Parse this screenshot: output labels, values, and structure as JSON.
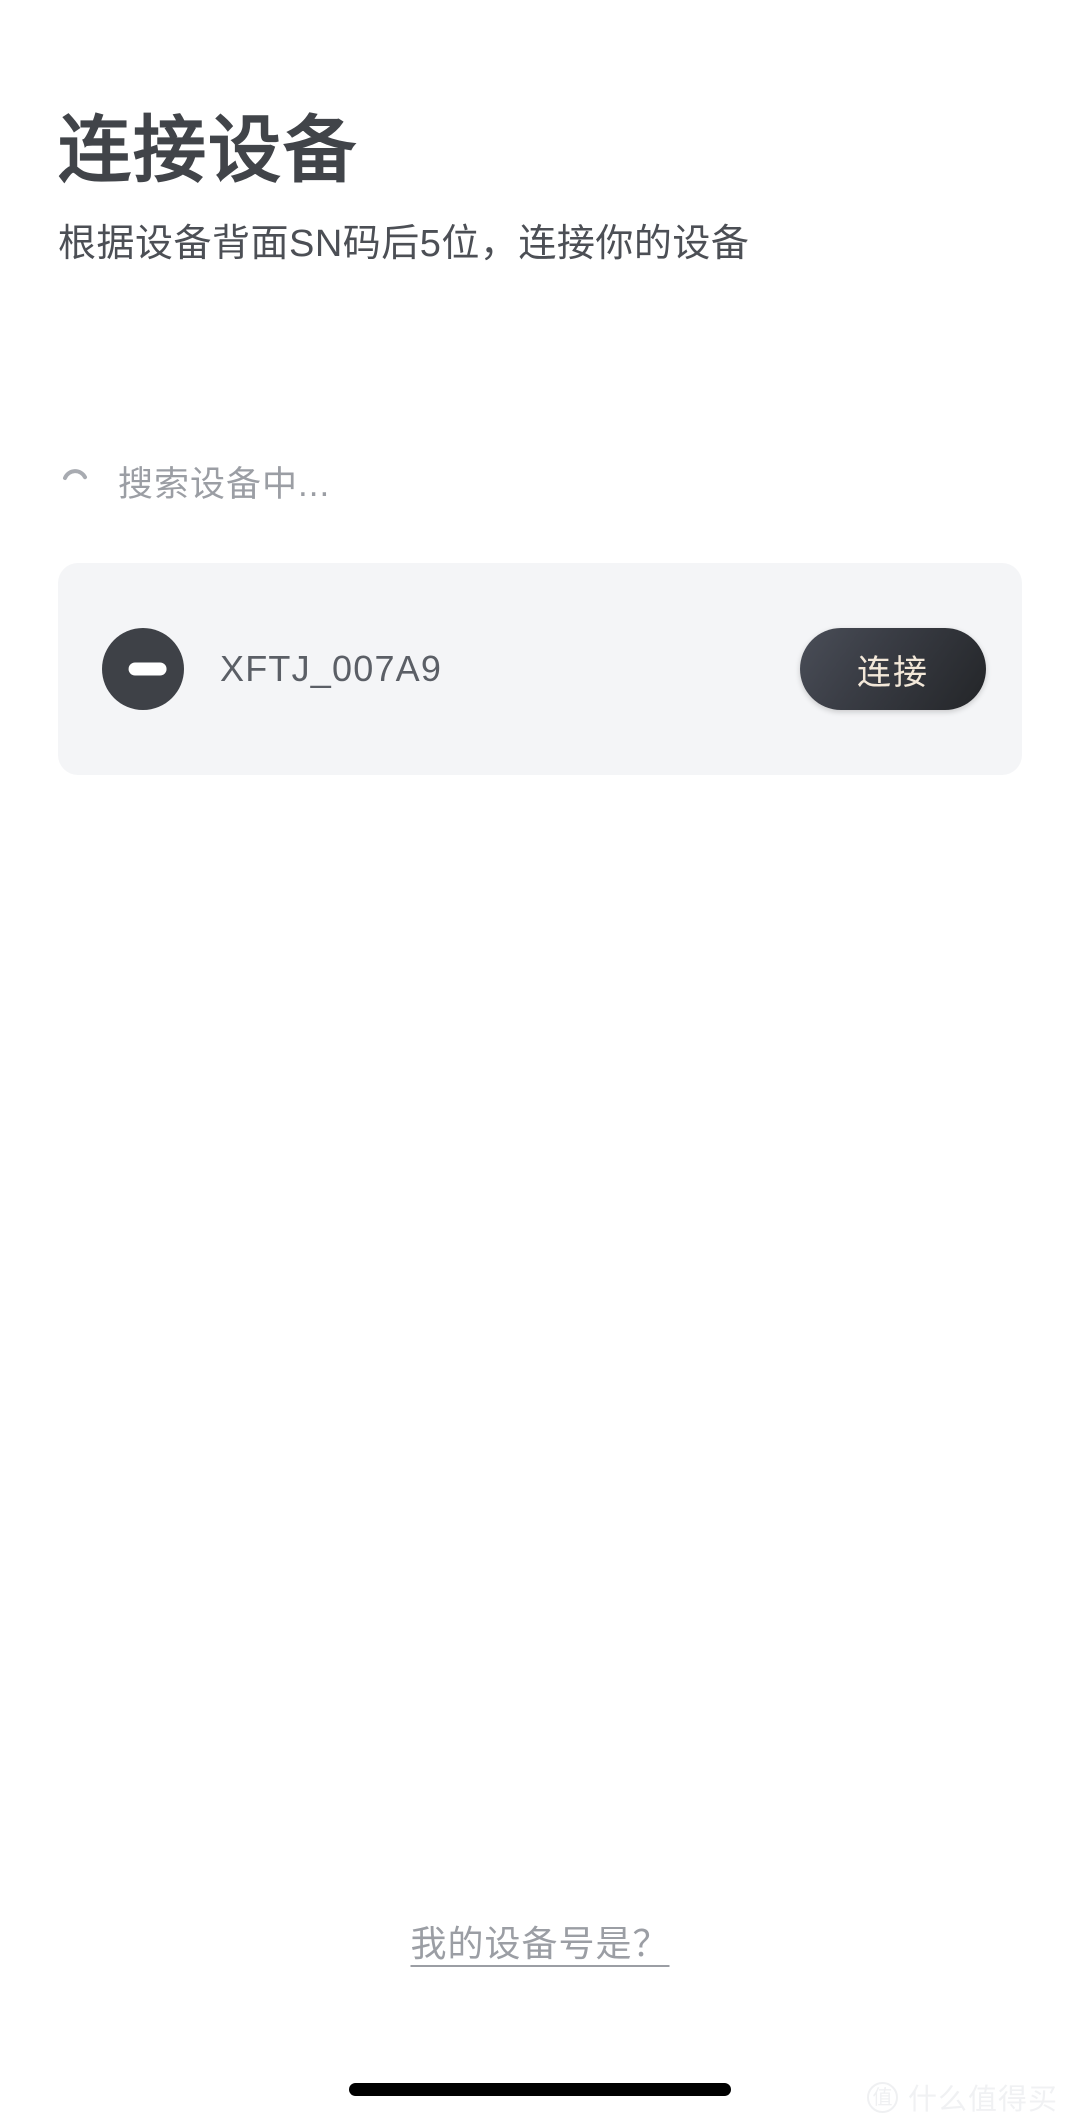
{
  "header": {
    "title": "连接设备",
    "subtitle": "根据设备背面SN码后5位，连接你的设备"
  },
  "status": {
    "icon": "loading-spinner-arc-icon",
    "text": "搜索设备中..."
  },
  "device_list": [
    {
      "icon": "device-dash-circle-icon",
      "name": "XFTJ_007A9",
      "action_label": "连接"
    }
  ],
  "footer": {
    "help_link": "我的设备号是？"
  },
  "watermark": {
    "mark": "值",
    "text": "什么值得买"
  },
  "colors": {
    "title": "#414449",
    "subtitle": "#4C4F55",
    "muted": "#9B9EA4",
    "card_bg": "#F4F5F7",
    "icon_dark": "#3E4147",
    "button_text": "#F3E8D9",
    "page_bg": "#FFFFFF"
  }
}
